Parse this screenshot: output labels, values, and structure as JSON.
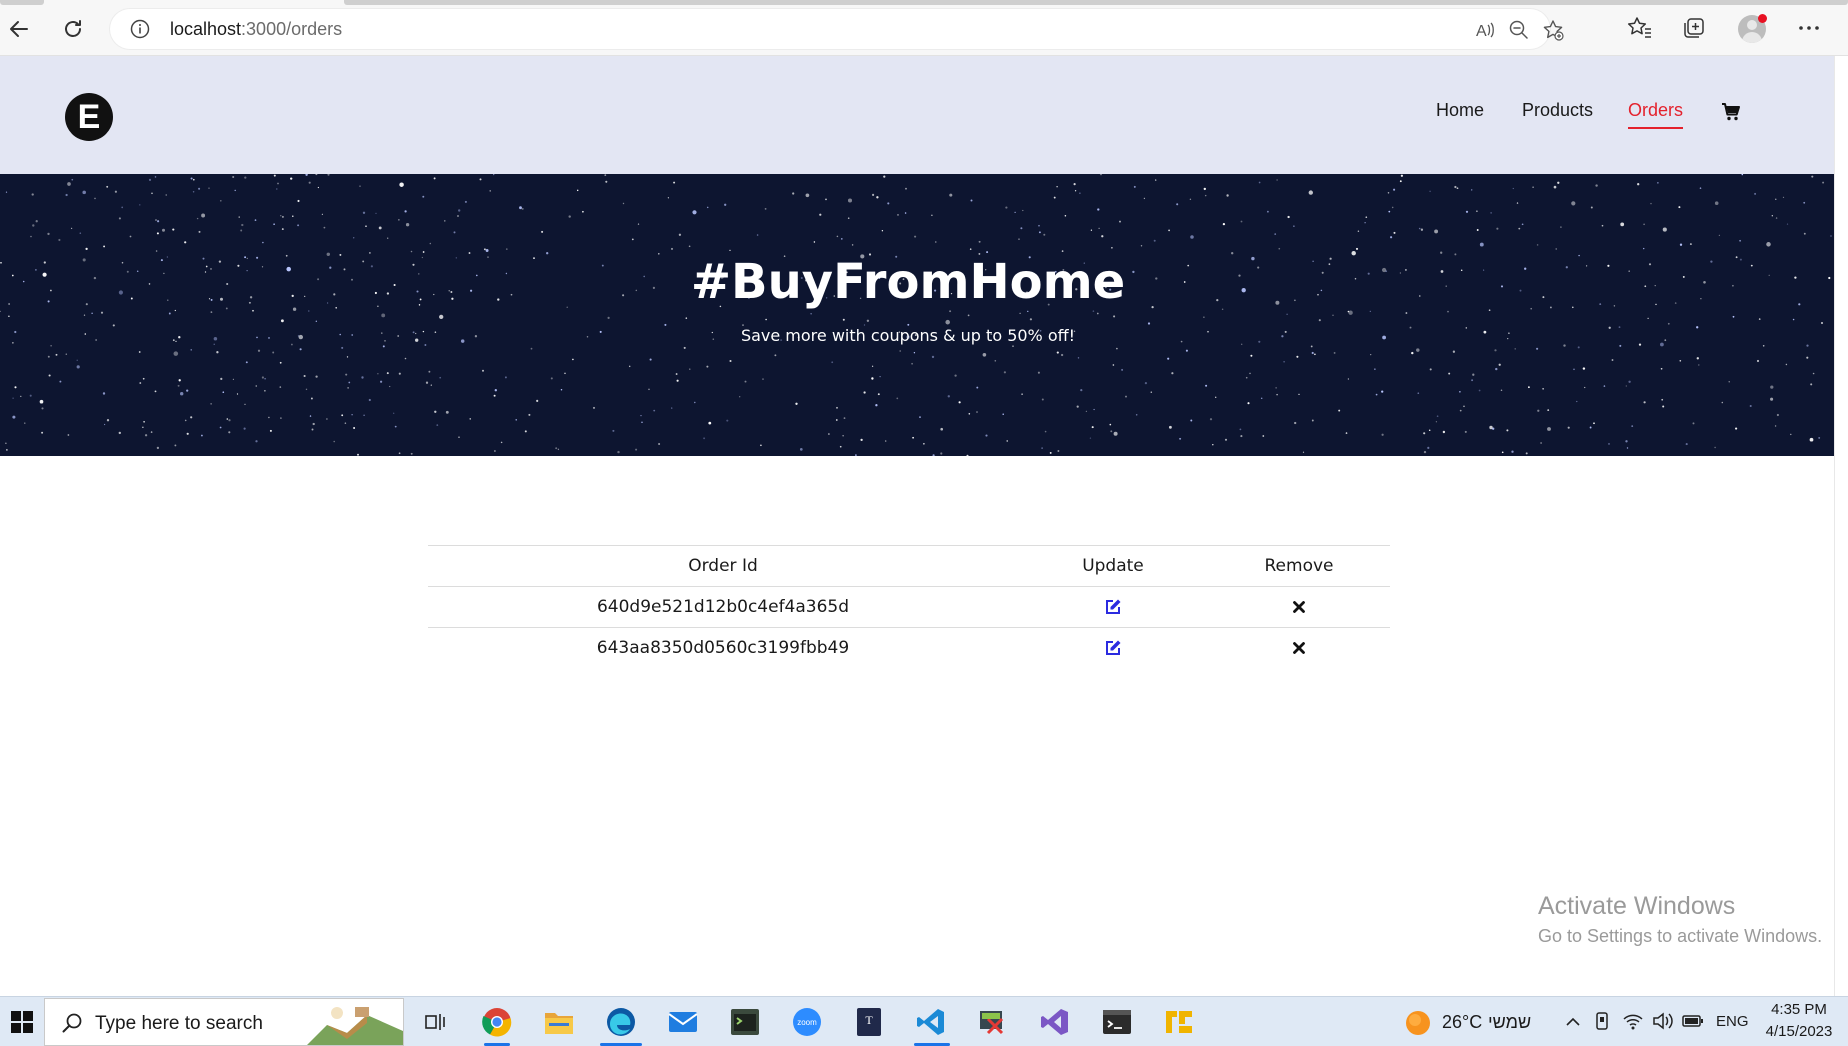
{
  "browser": {
    "url_host": "localhost",
    "url_path": ":3000/orders"
  },
  "site": {
    "logo_letter": "E",
    "nav": [
      {
        "label": "Home"
      },
      {
        "label": "Products"
      },
      {
        "label": "Orders",
        "active": true
      }
    ]
  },
  "hero": {
    "title": "#BuyFromHome",
    "subtitle": "Save more with coupons & up to 50% off!"
  },
  "orders": {
    "columns": [
      "Order Id",
      "Update",
      "Remove"
    ],
    "rows": [
      {
        "id": "640d9e521d12b0c4ef4a365d"
      },
      {
        "id": "643aa8350d0560c3199fbb49"
      }
    ]
  },
  "watermark": {
    "title": "Activate Windows",
    "subtitle": "Go to Settings to activate Windows."
  },
  "taskbar": {
    "search_placeholder": "Type here to search",
    "weather": "26°C",
    "weather_label": "שמשי",
    "language": "ENG",
    "time": "4:35 PM",
    "date": "4/15/2023"
  },
  "colors": {
    "header_bg": "#e3e6f3",
    "accent": "#e4212c",
    "edit_icon": "#2b2be0"
  }
}
